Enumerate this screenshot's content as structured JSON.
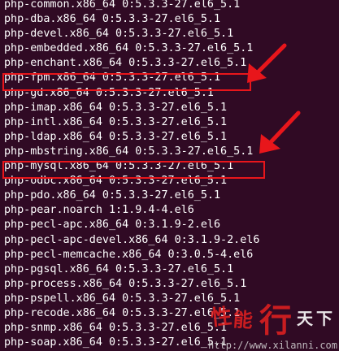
{
  "terminal": {
    "lines": [
      "php-common.x86_64 0:5.3.3-27.el6_5.1",
      "php-dba.x86_64 0:5.3.3-27.el6_5.1",
      "php-devel.x86_64 0:5.3.3-27.el6_5.1",
      "php-embedded.x86_64 0:5.3.3-27.el6_5.1",
      "php-enchant.x86_64 0:5.3.3-27.el6_5.1",
      "php-fpm.x86_64 0:5.3.3-27.el6_5.1",
      "php-gd.x86_64 0:5.3.3-27.el6_5.1",
      "php-imap.x86_64 0:5.3.3-27.el6_5.1",
      "php-intl.x86_64 0:5.3.3-27.el6_5.1",
      "php-ldap.x86_64 0:5.3.3-27.el6_5.1",
      "php-mbstring.x86_64 0:5.3.3-27.el6_5.1",
      "php-mysql.x86_64 0:5.3.3-27.el6_5.1",
      "php-odbc.x86_64 0:5.3.3-27.el6_5.1",
      "php-pdo.x86_64 0:5.3.3-27.el6_5.1",
      "php-pear.noarch 1:1.9.4-4.el6",
      "php-pecl-apc.x86_64 0:3.1.9-2.el6",
      "php-pecl-apc-devel.x86_64 0:3.1.9-2.el6",
      "php-pecl-memcache.x86_64 0:3.0.5-4.el6",
      "php-pgsql.x86_64 0:5.3.3-27.el6_5.1",
      "php-process.x86_64 0:5.3.3-27.el6_5.1",
      "php-pspell.x86_64 0:5.3.3-27.el6_5.1",
      "php-recode.x86_64 0:5.3.3-27.el6_5.1",
      "php-snmp.x86_64 0:5.3.3-27.el6_5.1",
      "php-soap.x86_64 0:5.3.3-27.el6_5.1"
    ],
    "highlighted_lines": [
      "php-fpm.x86_64 0:5.3.3-27.el6_5.1",
      "php-mysql.x86_64 0:5.3.3-27.el6_5.1"
    ],
    "text_color": "#ffffff",
    "background_color": "#300a24"
  },
  "annotations": {
    "highlight_color": "#e8161b",
    "arrow_color": "#e8161b"
  },
  "watermark": {
    "chars": [
      "性",
      "能",
      "行",
      "天",
      "下"
    ],
    "url": "http://www.xilanni.com",
    "color": "#e02020"
  }
}
